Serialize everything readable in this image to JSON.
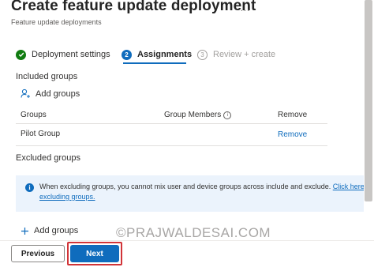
{
  "header": {
    "title": "Create feature update deployment",
    "more_icon": "…",
    "subtitle": "Feature update deployments"
  },
  "steps": [
    {
      "number": "",
      "label": "Deployment settings",
      "state": "done"
    },
    {
      "number": "2",
      "label": "Assignments",
      "state": "current"
    },
    {
      "number": "3",
      "label": "Review + create",
      "state": "todo"
    }
  ],
  "included": {
    "title": "Included groups",
    "add_label": "Add groups",
    "columns": {
      "groups": "Groups",
      "members": "Group Members",
      "remove": "Remove"
    },
    "rows": [
      {
        "group": "Pilot Group",
        "members": "",
        "remove": "Remove"
      }
    ]
  },
  "excluded": {
    "title": "Excluded groups",
    "add_label": "Add groups",
    "banner": {
      "text": "When excluding groups, you cannot mix user and device groups across include and exclude.",
      "link_part1": "Click here to learn",
      "link_part2": "excluding groups."
    }
  },
  "watermark": "©PRAJWALDESAI.COM",
  "footer": {
    "previous_label": "Previous",
    "next_label": "Next"
  },
  "colors": {
    "accent": "#0f6cbd",
    "success": "#107c10",
    "highlight": "#d13438"
  }
}
